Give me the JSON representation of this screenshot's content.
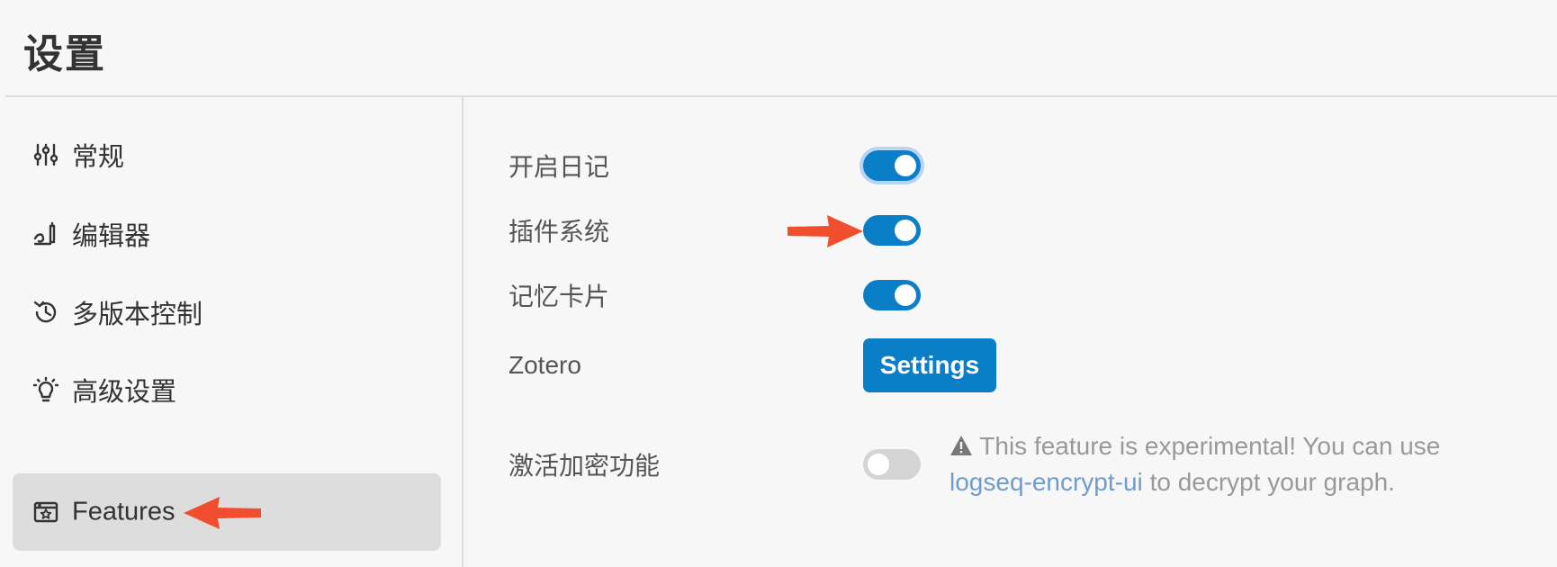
{
  "header": {
    "title": "设置"
  },
  "sidebar": {
    "items": [
      {
        "label": "常规",
        "icon": "sliders-icon"
      },
      {
        "label": "编辑器",
        "icon": "editor-pen-icon"
      },
      {
        "label": "多版本控制",
        "icon": "history-icon"
      },
      {
        "label": "高级设置",
        "icon": "bulb-icon"
      },
      {
        "label": "Features",
        "icon": "features-icon",
        "active": true
      }
    ]
  },
  "main": {
    "rows": [
      {
        "label": "开启日记",
        "control": "toggle",
        "state": "on"
      },
      {
        "label": "插件系统",
        "control": "toggle",
        "state": "on"
      },
      {
        "label": "记忆卡片",
        "control": "toggle",
        "state": "on"
      },
      {
        "label": "Zotero",
        "control": "button",
        "button_label": "Settings"
      },
      {
        "label": "激活加密功能",
        "control": "toggle",
        "state": "off"
      }
    ],
    "encryption_note": {
      "icon": "warning-icon",
      "text_before": "This feature is experimental! You can use",
      "link": "logseq-encrypt-ui",
      "text_after": "to decrypt your graph."
    }
  },
  "colors": {
    "accent": "#0a7fc8",
    "annotation_arrow": "#f04e2e",
    "active_nav_bg": "#dddddd",
    "link": "#6f9ccc"
  }
}
